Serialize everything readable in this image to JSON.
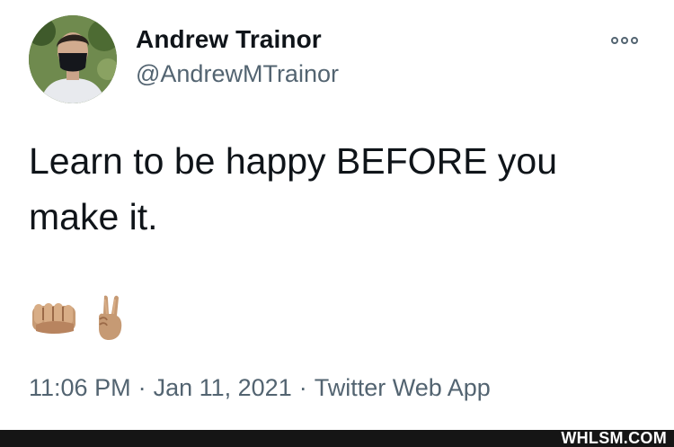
{
  "author": {
    "name": "Andrew Trainor",
    "handle": "@AndrewMTrainor"
  },
  "tweet": {
    "text": "Learn to be happy BEFORE you make it.",
    "emojis": [
      "fist-icon",
      "victory-hand-icon"
    ]
  },
  "meta": {
    "time": "11:06 PM",
    "date": "Jan 11, 2021",
    "separator": "·",
    "source": "Twitter Web App"
  },
  "watermark": "WHLSM.COM",
  "colors": {
    "primary_text": "#0f1419",
    "secondary_text": "#536471",
    "footer_bg": "#151515",
    "skin_tone": "#c69a74"
  }
}
